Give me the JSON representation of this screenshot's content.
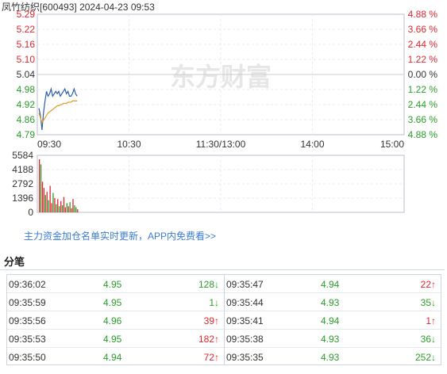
{
  "header": {
    "stock_name": "凤竹纺织",
    "stock_code": "[600493]",
    "date": "2024-04-23",
    "time": "09:53"
  },
  "colors": {
    "up": "#e0262e",
    "down": "#2a9d2a",
    "neutral": "#333333",
    "price_line": "#2b5fa8",
    "avg_line": "#d8a02b",
    "link": "#3a7bd5"
  },
  "watermark_text": "东方财富",
  "chart_data": [
    {
      "type": "line",
      "title": "",
      "prev_close": 5.04,
      "y_ticks": [
        {
          "price": "5.29",
          "pct": "4.88 %",
          "dir": "up"
        },
        {
          "price": "5.22",
          "pct": "3.66 %",
          "dir": "up"
        },
        {
          "price": "5.16",
          "pct": "2.44 %",
          "dir": "up"
        },
        {
          "price": "5.10",
          "pct": "1.22 %",
          "dir": "up"
        },
        {
          "price": "5.04",
          "pct": "0.00 %",
          "dir": "flat"
        },
        {
          "price": "4.98",
          "pct": "1.22 %",
          "dir": "down"
        },
        {
          "price": "4.92",
          "pct": "2.44 %",
          "dir": "down"
        },
        {
          "price": "4.86",
          "pct": "3.66 %",
          "dir": "down"
        },
        {
          "price": "4.79",
          "pct": "4.88 %",
          "dir": "down"
        }
      ],
      "ylim": [
        4.79,
        5.29
      ],
      "x_ticks": [
        "09:30",
        "10:30",
        "11:30/13:00",
        "14:00",
        "15:00"
      ],
      "minutes_total": 240,
      "series": [
        {
          "role": "price",
          "values": [
            4.9,
            4.87,
            4.81,
            4.88,
            4.93,
            4.97,
            4.95,
            4.96,
            4.98,
            4.95,
            4.96,
            4.97,
            4.96,
            4.97,
            4.95,
            4.96,
            4.97,
            4.98,
            4.96,
            4.97,
            4.95,
            4.95,
            4.96,
            4.98,
            4.96,
            4.95
          ]
        },
        {
          "role": "average",
          "values": [
            4.88,
            4.86,
            4.84,
            4.85,
            4.86,
            4.87,
            4.88,
            4.885,
            4.89,
            4.895,
            4.9,
            4.905,
            4.91,
            4.91,
            4.915,
            4.915,
            4.92,
            4.92,
            4.92,
            4.925,
            4.925,
            4.925,
            4.93,
            4.93,
            4.93,
            4.93
          ]
        }
      ]
    },
    {
      "type": "bar",
      "title": "",
      "y_ticks": [
        "5584",
        "4188",
        "2792",
        "1396",
        "0"
      ],
      "ylim": [
        0,
        5584
      ],
      "values": [
        5200,
        4700,
        3000,
        2400,
        1700,
        2000,
        1200,
        2600,
        900,
        1900,
        1400,
        800,
        1300,
        600,
        1100,
        700,
        1500,
        500,
        900,
        600,
        1000,
        400,
        1300,
        700,
        500,
        300
      ],
      "bar_dirs": [
        "up",
        "down",
        "up",
        "up",
        "down",
        "up",
        "down",
        "up",
        "up",
        "down",
        "up",
        "down",
        "up",
        "down",
        "up",
        "down",
        "up",
        "up",
        "down",
        "up",
        "down",
        "up",
        "up",
        "down",
        "down",
        "up"
      ]
    }
  ],
  "promo_text": "主力资金加仓名单实时更新，APP内免费看>>",
  "ticks_title": "分笔",
  "ticks_left": [
    {
      "time": "09:36:02",
      "price": "4.95",
      "vol": "128↓",
      "price_dir": "down",
      "dir": "down"
    },
    {
      "time": "09:35:59",
      "price": "4.95",
      "vol": "1↓",
      "price_dir": "down",
      "dir": "down"
    },
    {
      "time": "09:35:56",
      "price": "4.96",
      "vol": "39↑",
      "price_dir": "down",
      "dir": "up"
    },
    {
      "time": "09:35:53",
      "price": "4.95",
      "vol": "182↑",
      "price_dir": "down",
      "dir": "up"
    },
    {
      "time": "09:35:50",
      "price": "4.94",
      "vol": "72↑",
      "price_dir": "down",
      "dir": "up"
    }
  ],
  "ticks_right": [
    {
      "time": "09:35:47",
      "price": "4.94",
      "vol": "22↑",
      "price_dir": "down",
      "dir": "up"
    },
    {
      "time": "09:35:44",
      "price": "4.93",
      "vol": "35↓",
      "price_dir": "down",
      "dir": "down"
    },
    {
      "time": "09:35:41",
      "price": "4.94",
      "vol": "1↑",
      "price_dir": "down",
      "dir": "up"
    },
    {
      "time": "09:35:38",
      "price": "4.93",
      "vol": "36↓",
      "price_dir": "down",
      "dir": "down"
    },
    {
      "time": "09:35:35",
      "price": "4.93",
      "vol": "252↓",
      "price_dir": "down",
      "dir": "down"
    }
  ]
}
